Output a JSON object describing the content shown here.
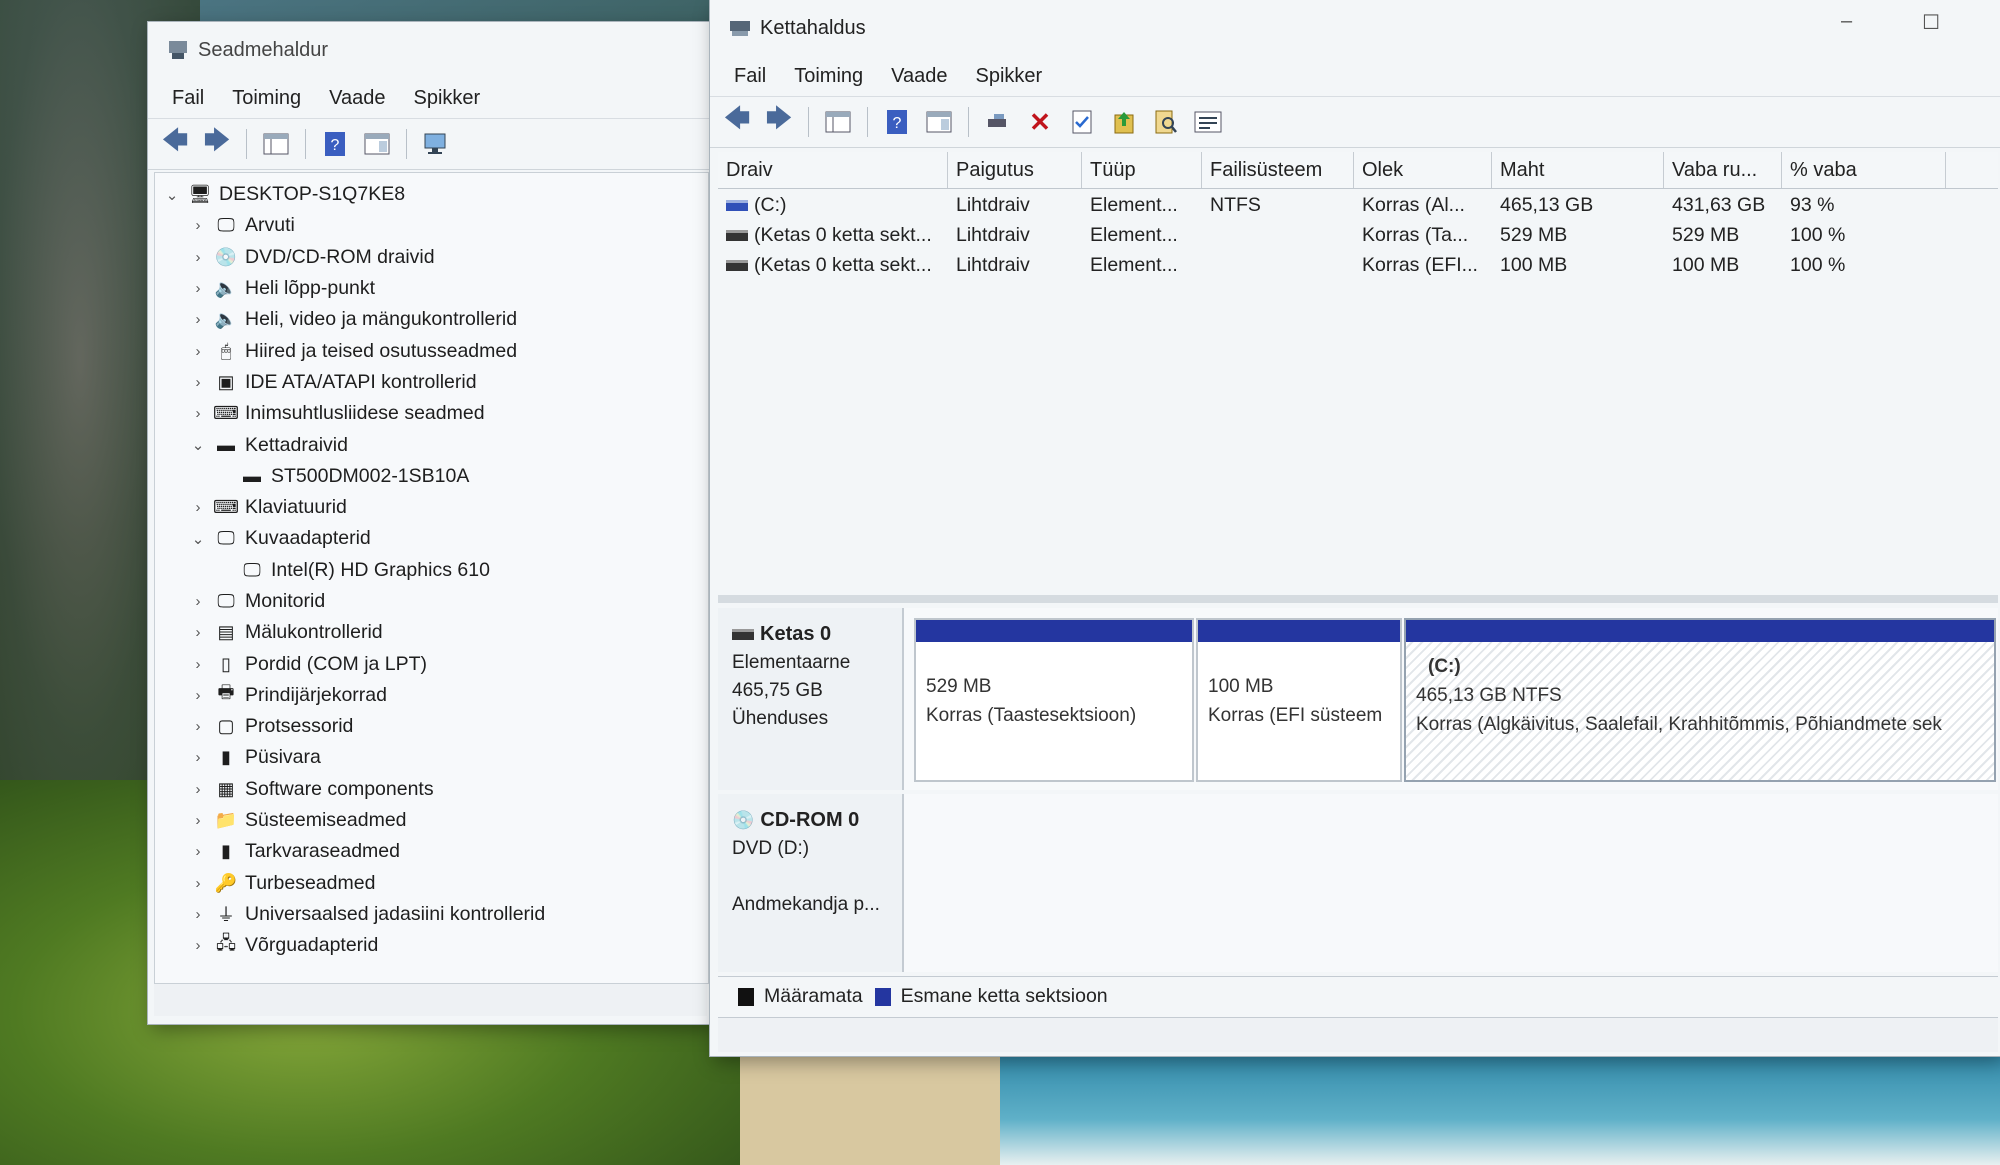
{
  "device_manager": {
    "title": "Seadmehaldur",
    "menu": [
      "Fail",
      "Toiming",
      "Vaade",
      "Spikker"
    ],
    "tree": [
      {
        "label": "DESKTOP-S1Q7KE8",
        "level": 0,
        "expanded": true,
        "icon": "computer-icon"
      },
      {
        "label": "Arvuti",
        "level": 1,
        "icon": "monitor-icon"
      },
      {
        "label": "DVD/CD-ROM draivid",
        "level": 1,
        "icon": "disc-drive-icon"
      },
      {
        "label": "Heli lõpp-punkt",
        "level": 1,
        "icon": "speaker-icon"
      },
      {
        "label": "Heli, video ja mängukontrollerid",
        "level": 1,
        "icon": "speaker-icon"
      },
      {
        "label": "Hiired ja teised osutusseadmed",
        "level": 1,
        "icon": "mouse-icon"
      },
      {
        "label": "IDE ATA/ATAPI kontrollerid",
        "level": 1,
        "icon": "controller-icon"
      },
      {
        "label": "Inimsuhtlusliidese seadmed",
        "level": 1,
        "icon": "hid-icon"
      },
      {
        "label": "Kettadraivid",
        "level": 1,
        "expanded": true,
        "icon": "disk-drive-icon"
      },
      {
        "label": "ST500DM002-1SB10A",
        "level": 2,
        "icon": "disk-drive-icon"
      },
      {
        "label": "Klaviatuurid",
        "level": 1,
        "icon": "keyboard-icon"
      },
      {
        "label": "Kuvaadapterid",
        "level": 1,
        "expanded": true,
        "icon": "display-adapter-icon"
      },
      {
        "label": "Intel(R) HD Graphics 610",
        "level": 2,
        "icon": "display-adapter-icon"
      },
      {
        "label": "Monitorid",
        "level": 1,
        "icon": "monitor-icon"
      },
      {
        "label": "Mälukontrollerid",
        "level": 1,
        "icon": "storage-controller-icon"
      },
      {
        "label": "Pordid (COM ja LPT)",
        "level": 1,
        "icon": "port-icon"
      },
      {
        "label": "Prindijärjekorrad",
        "level": 1,
        "icon": "printer-icon"
      },
      {
        "label": "Protsessorid",
        "level": 1,
        "icon": "cpu-icon"
      },
      {
        "label": "Püsivara",
        "level": 1,
        "icon": "firmware-icon"
      },
      {
        "label": "Software components",
        "level": 1,
        "icon": "software-icon"
      },
      {
        "label": "Süsteemiseadmed",
        "level": 1,
        "icon": "folder-icon"
      },
      {
        "label": "Tarkvaraseadmed",
        "level": 1,
        "icon": "software-device-icon"
      },
      {
        "label": "Turbeseadmed",
        "level": 1,
        "icon": "security-icon"
      },
      {
        "label": "Universaalsed jadasiini kontrollerid",
        "level": 1,
        "icon": "usb-icon"
      },
      {
        "label": "Võrguadapterid",
        "level": 1,
        "icon": "network-icon"
      }
    ]
  },
  "disk_management": {
    "title": "Kettahaldus",
    "menu": [
      "Fail",
      "Toiming",
      "Vaade",
      "Spikker"
    ],
    "columns": [
      "Draiv",
      "Paigutus",
      "Tüüp",
      "Failisüsteem",
      "Olek",
      "Maht",
      "Vaba ru...",
      "% vaba"
    ],
    "volumes": [
      {
        "drive": "(C:)",
        "layout": "Lihtdraiv",
        "type": "Element...",
        "fs": "NTFS",
        "status": "Korras (Al...",
        "capacity": "465,13 GB",
        "free": "431,63 GB",
        "pct": "93 %",
        "icon": "blue"
      },
      {
        "drive": "(Ketas 0 ketta sekt...",
        "layout": "Lihtdraiv",
        "type": "Element...",
        "fs": "",
        "status": "Korras (Ta...",
        "capacity": "529 MB",
        "free": "529 MB",
        "pct": "100 %",
        "icon": "dark"
      },
      {
        "drive": "(Ketas 0 ketta sekt...",
        "layout": "Lihtdraiv",
        "type": "Element...",
        "fs": "",
        "status": "Korras (EFI...",
        "capacity": "100 MB",
        "free": "100 MB",
        "pct": "100 %",
        "icon": "dark"
      }
    ],
    "disk0": {
      "name": "Ketas 0",
      "kind": "Elementaarne",
      "size": "465,75 GB",
      "state": "Ühenduses",
      "partitions": [
        {
          "label": "",
          "size": "529 MB",
          "status": "Korras (Taastesektsioon)"
        },
        {
          "label": "",
          "size": "100 MB",
          "status": "Korras (EFI süsteem"
        },
        {
          "label": "(C:)",
          "size": "465,13 GB NTFS",
          "status": "Korras (Algkäivitus, Saalefail, Krahhitõmmis, Põhiandmete sek"
        }
      ]
    },
    "cdrom0": {
      "name": "CD-ROM 0",
      "kind": "DVD (D:)",
      "state": "Andmekandja p..."
    },
    "legend": [
      {
        "label": "Määramata",
        "color": "#111111"
      },
      {
        "label": "Esmane ketta sektsioon",
        "color": "#2436a0"
      }
    ]
  }
}
